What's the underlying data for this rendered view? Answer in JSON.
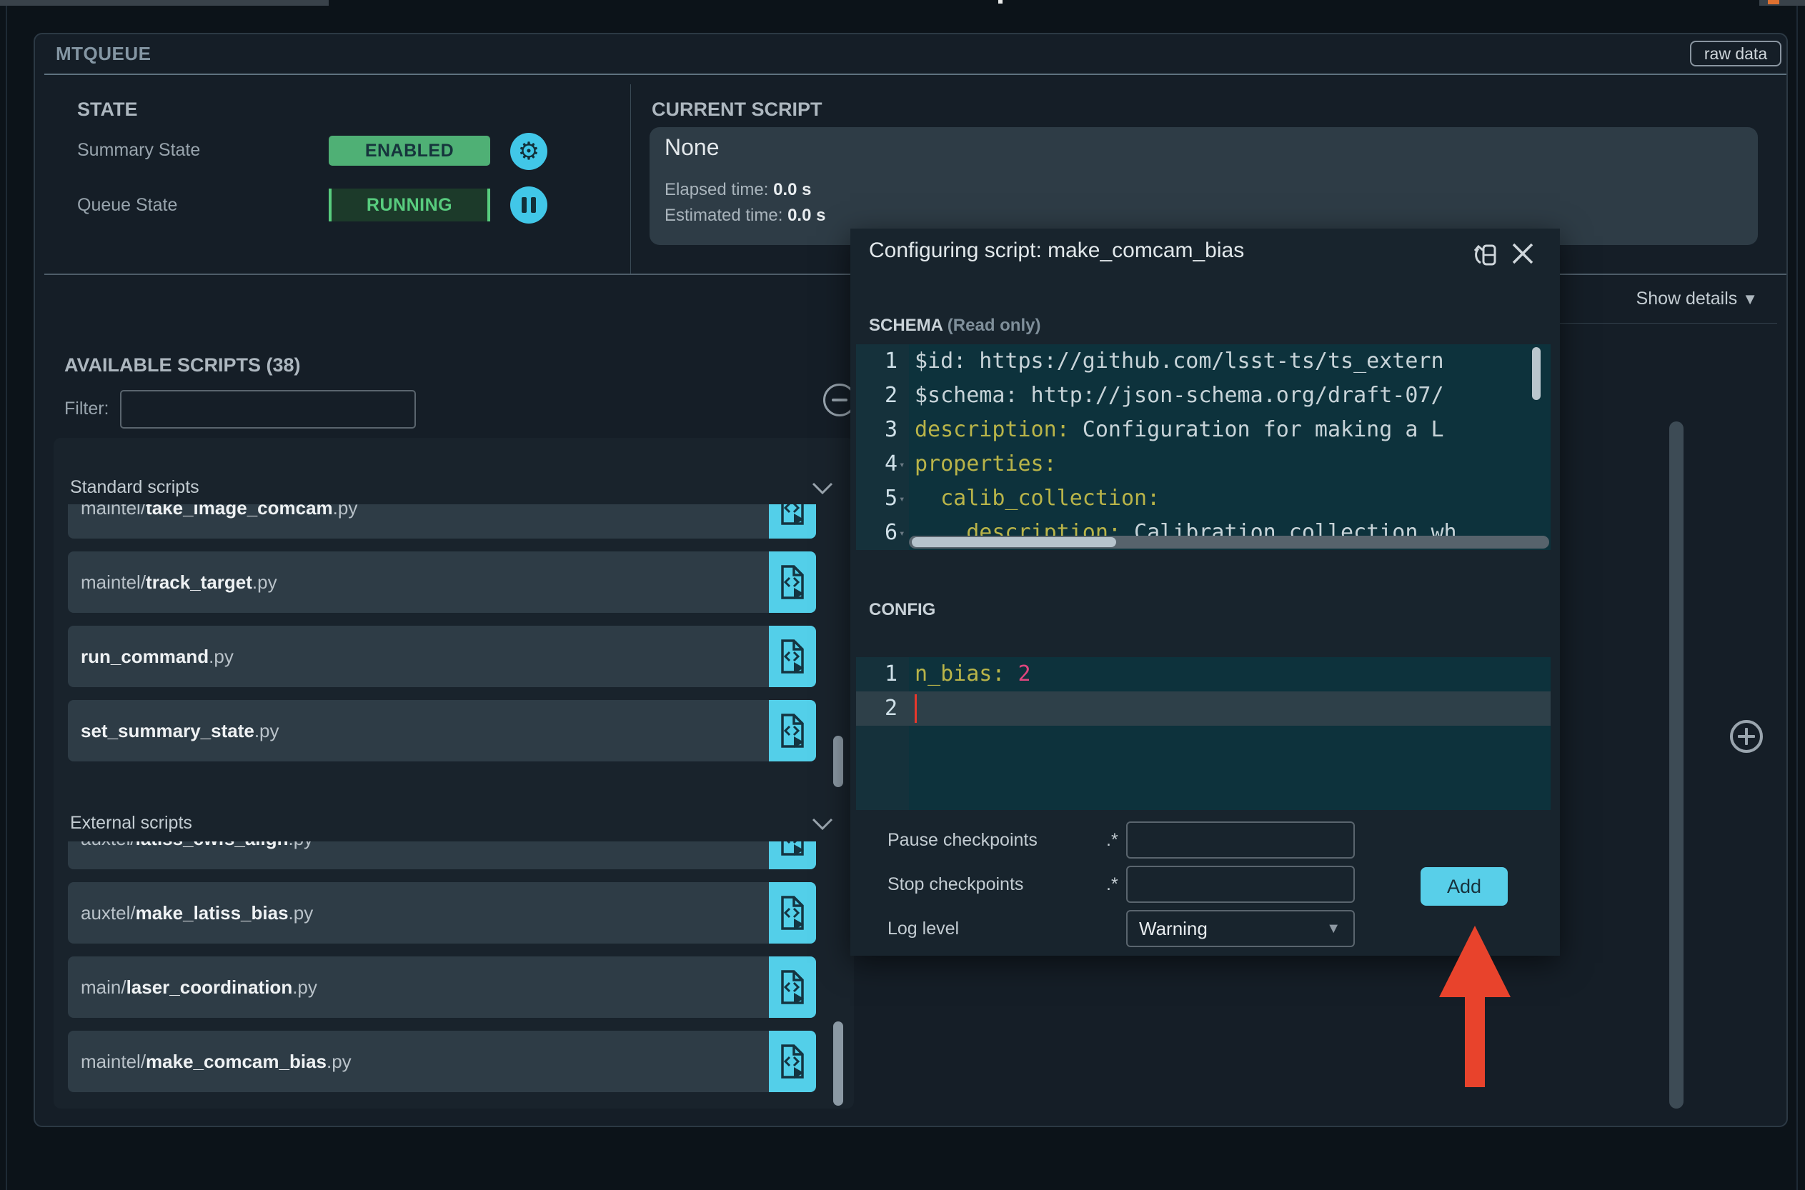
{
  "header": {
    "title": "MTQUEUE",
    "raw_data_label": "raw data"
  },
  "state": {
    "heading": "STATE",
    "summary": {
      "label": "Summary State",
      "value": "ENABLED"
    },
    "queue": {
      "label": "Queue State",
      "value": "RUNNING"
    }
  },
  "current_script": {
    "heading": "CURRENT SCRIPT",
    "name": "None",
    "elapsed_label": "Elapsed time:",
    "elapsed_value": "0.0 s",
    "estimated_label": "Estimated time:",
    "estimated_value": "0.0 s"
  },
  "show_details": {
    "label": "Show details",
    "icon": "▼"
  },
  "scripts": {
    "heading": "AVAILABLE SCRIPTS (38)",
    "filter_label": "Filter:",
    "filter_value": "",
    "groups": [
      {
        "label": "Standard scripts",
        "partial_item": {
          "path": "maintel/",
          "name": "take_image_comcam",
          "ext": ".py"
        },
        "items": [
          {
            "path": "maintel/",
            "name": "track_target",
            "ext": ".py"
          },
          {
            "path": "",
            "name": "run_command",
            "ext": ".py"
          },
          {
            "path": "",
            "name": "set_summary_state",
            "ext": ".py"
          }
        ]
      },
      {
        "label": "External scripts",
        "partial_item": {
          "path": "auxtel/",
          "name": "latiss_cwfs_align",
          "ext": ".py"
        },
        "items": [
          {
            "path": "auxtel/",
            "name": "make_latiss_bias",
            "ext": ".py"
          },
          {
            "path": "main/",
            "name": "laser_coordination",
            "ext": ".py"
          },
          {
            "path": "maintel/",
            "name": "make_comcam_bias",
            "ext": ".py"
          }
        ]
      }
    ]
  },
  "modal": {
    "title": "Configuring script: make_comcam_bias",
    "schema_label": "SCHEMA",
    "schema_readonly": "(Read only)",
    "schema_lines": [
      {
        "num": "1",
        "fold": false,
        "segments": [
          {
            "t": "$id: https://github.com/lsst-ts/ts_extern",
            "c": "plain"
          }
        ]
      },
      {
        "num": "2",
        "fold": false,
        "segments": [
          {
            "t": "$schema: http://json-schema.org/draft-07/",
            "c": "plain"
          }
        ]
      },
      {
        "num": "3",
        "fold": false,
        "segments": [
          {
            "t": "description:",
            "c": "key"
          },
          {
            "t": " Configuration for making a L",
            "c": "plain"
          }
        ]
      },
      {
        "num": "4",
        "fold": true,
        "segments": [
          {
            "t": "properties:",
            "c": "key"
          }
        ]
      },
      {
        "num": "5",
        "fold": true,
        "segments": [
          {
            "t": "  calib_collection:",
            "c": "key"
          }
        ]
      },
      {
        "num": "6",
        "fold": true,
        "segments": [
          {
            "t": "    description:",
            "c": "key"
          },
          {
            "t": " Calibration collection wh",
            "c": "plain"
          }
        ]
      }
    ],
    "config_label": "CONFIG",
    "config_lines": [
      {
        "num": "1",
        "active": false,
        "caret": false,
        "segments": [
          {
            "t": "n_bias: ",
            "c": "key"
          },
          {
            "t": "2",
            "c": "num"
          }
        ]
      },
      {
        "num": "2",
        "active": true,
        "caret": true,
        "segments": []
      }
    ],
    "fields": {
      "pause_label": "Pause checkpoints",
      "pause_regex": ".*",
      "pause_value": "",
      "stop_label": "Stop checkpoints",
      "stop_regex": ".*",
      "stop_value": "",
      "log_label": "Log level",
      "log_value": "Warning"
    },
    "add_label": "Add"
  },
  "icons": {
    "raw_data_border": "rounded-outline",
    "minus_circle": "collapse-panel",
    "plus_circle": "add-to-queue",
    "red_arrow": "points-at-add-button"
  },
  "colors": {
    "accent_cyan": "#41c7e8",
    "enabled_green": "#4fb075",
    "running_green": "#58cc7e",
    "arrow_red": "#e8432c",
    "code_key_olive": "#b9b449",
    "code_number_pink": "#e0457e",
    "panel_bg": "#151e27",
    "card_bg": "#2e3c46"
  }
}
